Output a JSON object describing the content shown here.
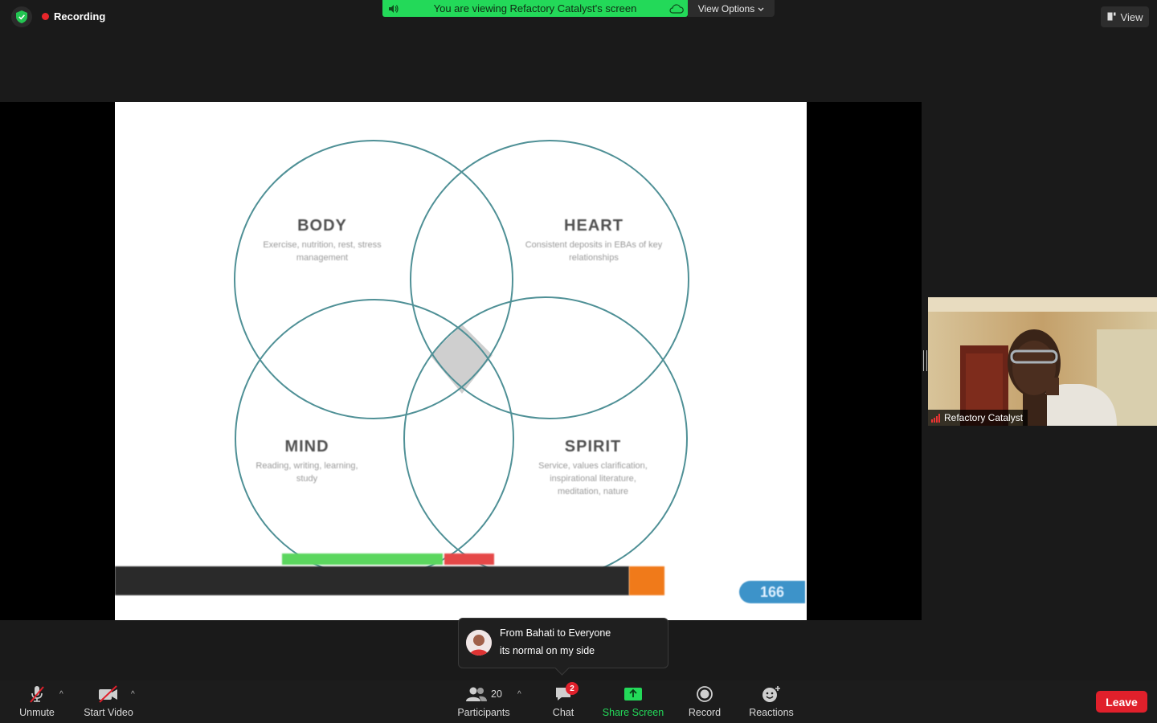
{
  "header": {
    "recording_label": "Recording",
    "banner_text": "You are viewing Refactory Catalyst's screen",
    "view_options_label": "View Options",
    "view_label": "View"
  },
  "slide": {
    "circles": [
      {
        "title": "BODY",
        "subtitle": "Exercise, nutrition, rest, stress management"
      },
      {
        "title": "HEART",
        "subtitle": "Consistent deposits in EBAs of key relationships"
      },
      {
        "title": "MIND",
        "subtitle": "Reading, writing, learning, study"
      },
      {
        "title": "SPIRIT",
        "subtitle": "Service, values clarification, inspirational literature, meditation, nature"
      }
    ],
    "page_number": "166"
  },
  "video": {
    "participant_name": "Refactory Catalyst"
  },
  "chat_toast": {
    "from": "From Bahati to Everyone",
    "message": "its normal on my side"
  },
  "toolbar": {
    "unmute_label": "Unmute",
    "start_video_label": "Start Video",
    "participants_label": "Participants",
    "participants_count": "20",
    "chat_label": "Chat",
    "chat_badge": "2",
    "share_screen_label": "Share Screen",
    "record_label": "Record",
    "reactions_label": "Reactions",
    "leave_label": "Leave"
  },
  "colors": {
    "zoom_green": "#23d959",
    "leave_red": "#e0202b",
    "circle_stroke": "#4f9096"
  }
}
